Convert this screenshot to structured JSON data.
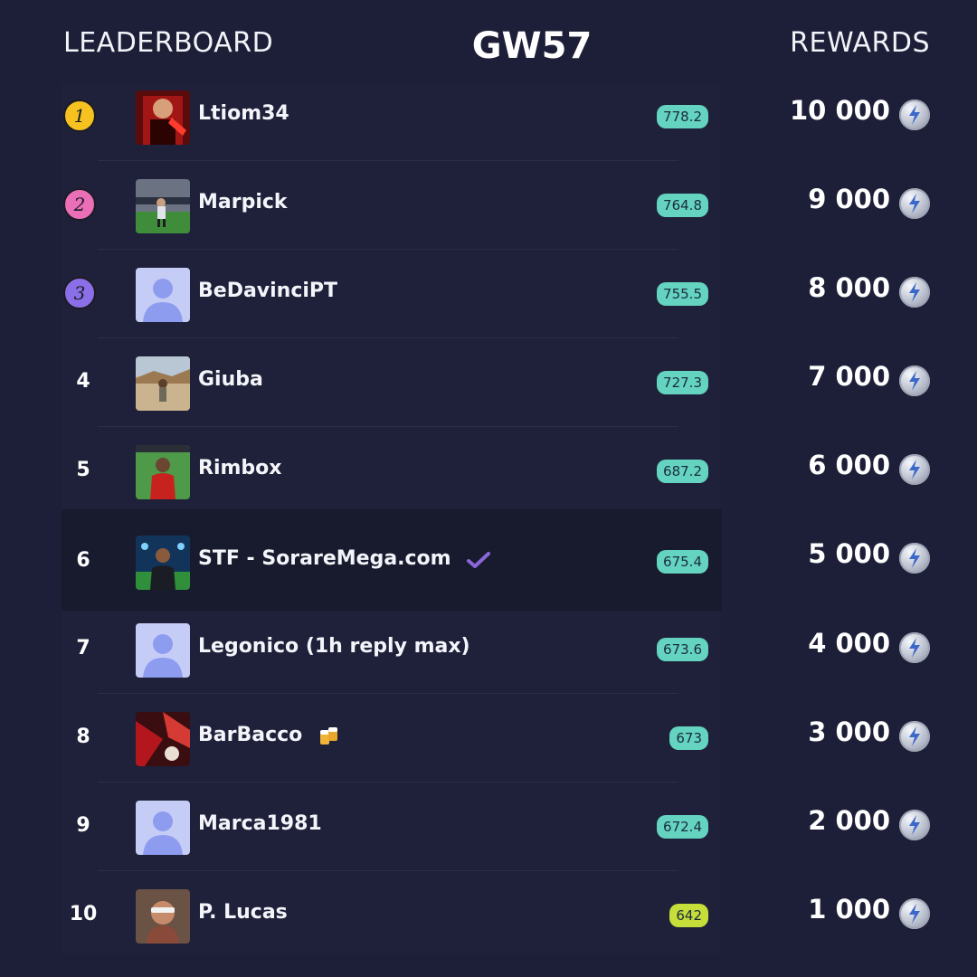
{
  "header": {
    "left": "LEADERBOARD",
    "center": "GW57",
    "right": "REWARDS"
  },
  "colors": {
    "background": "#1c1f37",
    "score_pill": "#64d4c1",
    "score_pill_low": "#c6de3a",
    "medal_gold": "#f5c21f",
    "medal_pink": "#ea6fb7",
    "medal_purple": "#8b6fe8",
    "verified": "#8a67d8"
  },
  "rows": [
    {
      "rank": "1",
      "name": "Ltiom34",
      "score": "778.2",
      "reward": "10 000",
      "avatar": "red-player-avatar"
    },
    {
      "rank": "2",
      "name": "Marpick",
      "score": "764.8",
      "reward": "9 000",
      "avatar": "pitch-player-avatar"
    },
    {
      "rank": "3",
      "name": "BeDavinciPT",
      "score": "755.5",
      "reward": "8 000",
      "avatar": "default-user-avatar"
    },
    {
      "rank": "4",
      "name": "Giuba",
      "score": "727.3",
      "reward": "7 000",
      "avatar": "desert-avatar"
    },
    {
      "rank": "5",
      "name": "Rimbox",
      "score": "687.2",
      "reward": "6 000",
      "avatar": "pitch-red-shirt-avatar"
    },
    {
      "rank": "6",
      "name": "STF - SorareMega.com",
      "score": "675.4",
      "reward": "5 000",
      "avatar": "stadium-man-avatar",
      "badge": "verified-check-icon"
    },
    {
      "rank": "7",
      "name": "Legonico (1h reply max)",
      "score": "673.6",
      "reward": "4 000",
      "avatar": "default-user-avatar"
    },
    {
      "rank": "8",
      "name": "BarBacco",
      "score": "673",
      "reward": "3 000",
      "avatar": "red-abstract-avatar",
      "badge": "beer-mugs-emoji"
    },
    {
      "rank": "9",
      "name": "Marca1981",
      "score": "672.4",
      "reward": "2 000",
      "avatar": "default-user-avatar"
    },
    {
      "rank": "10",
      "name": "P. Lucas",
      "score": "642",
      "reward": "1 000",
      "avatar": "sunglasses-man-avatar"
    }
  ]
}
